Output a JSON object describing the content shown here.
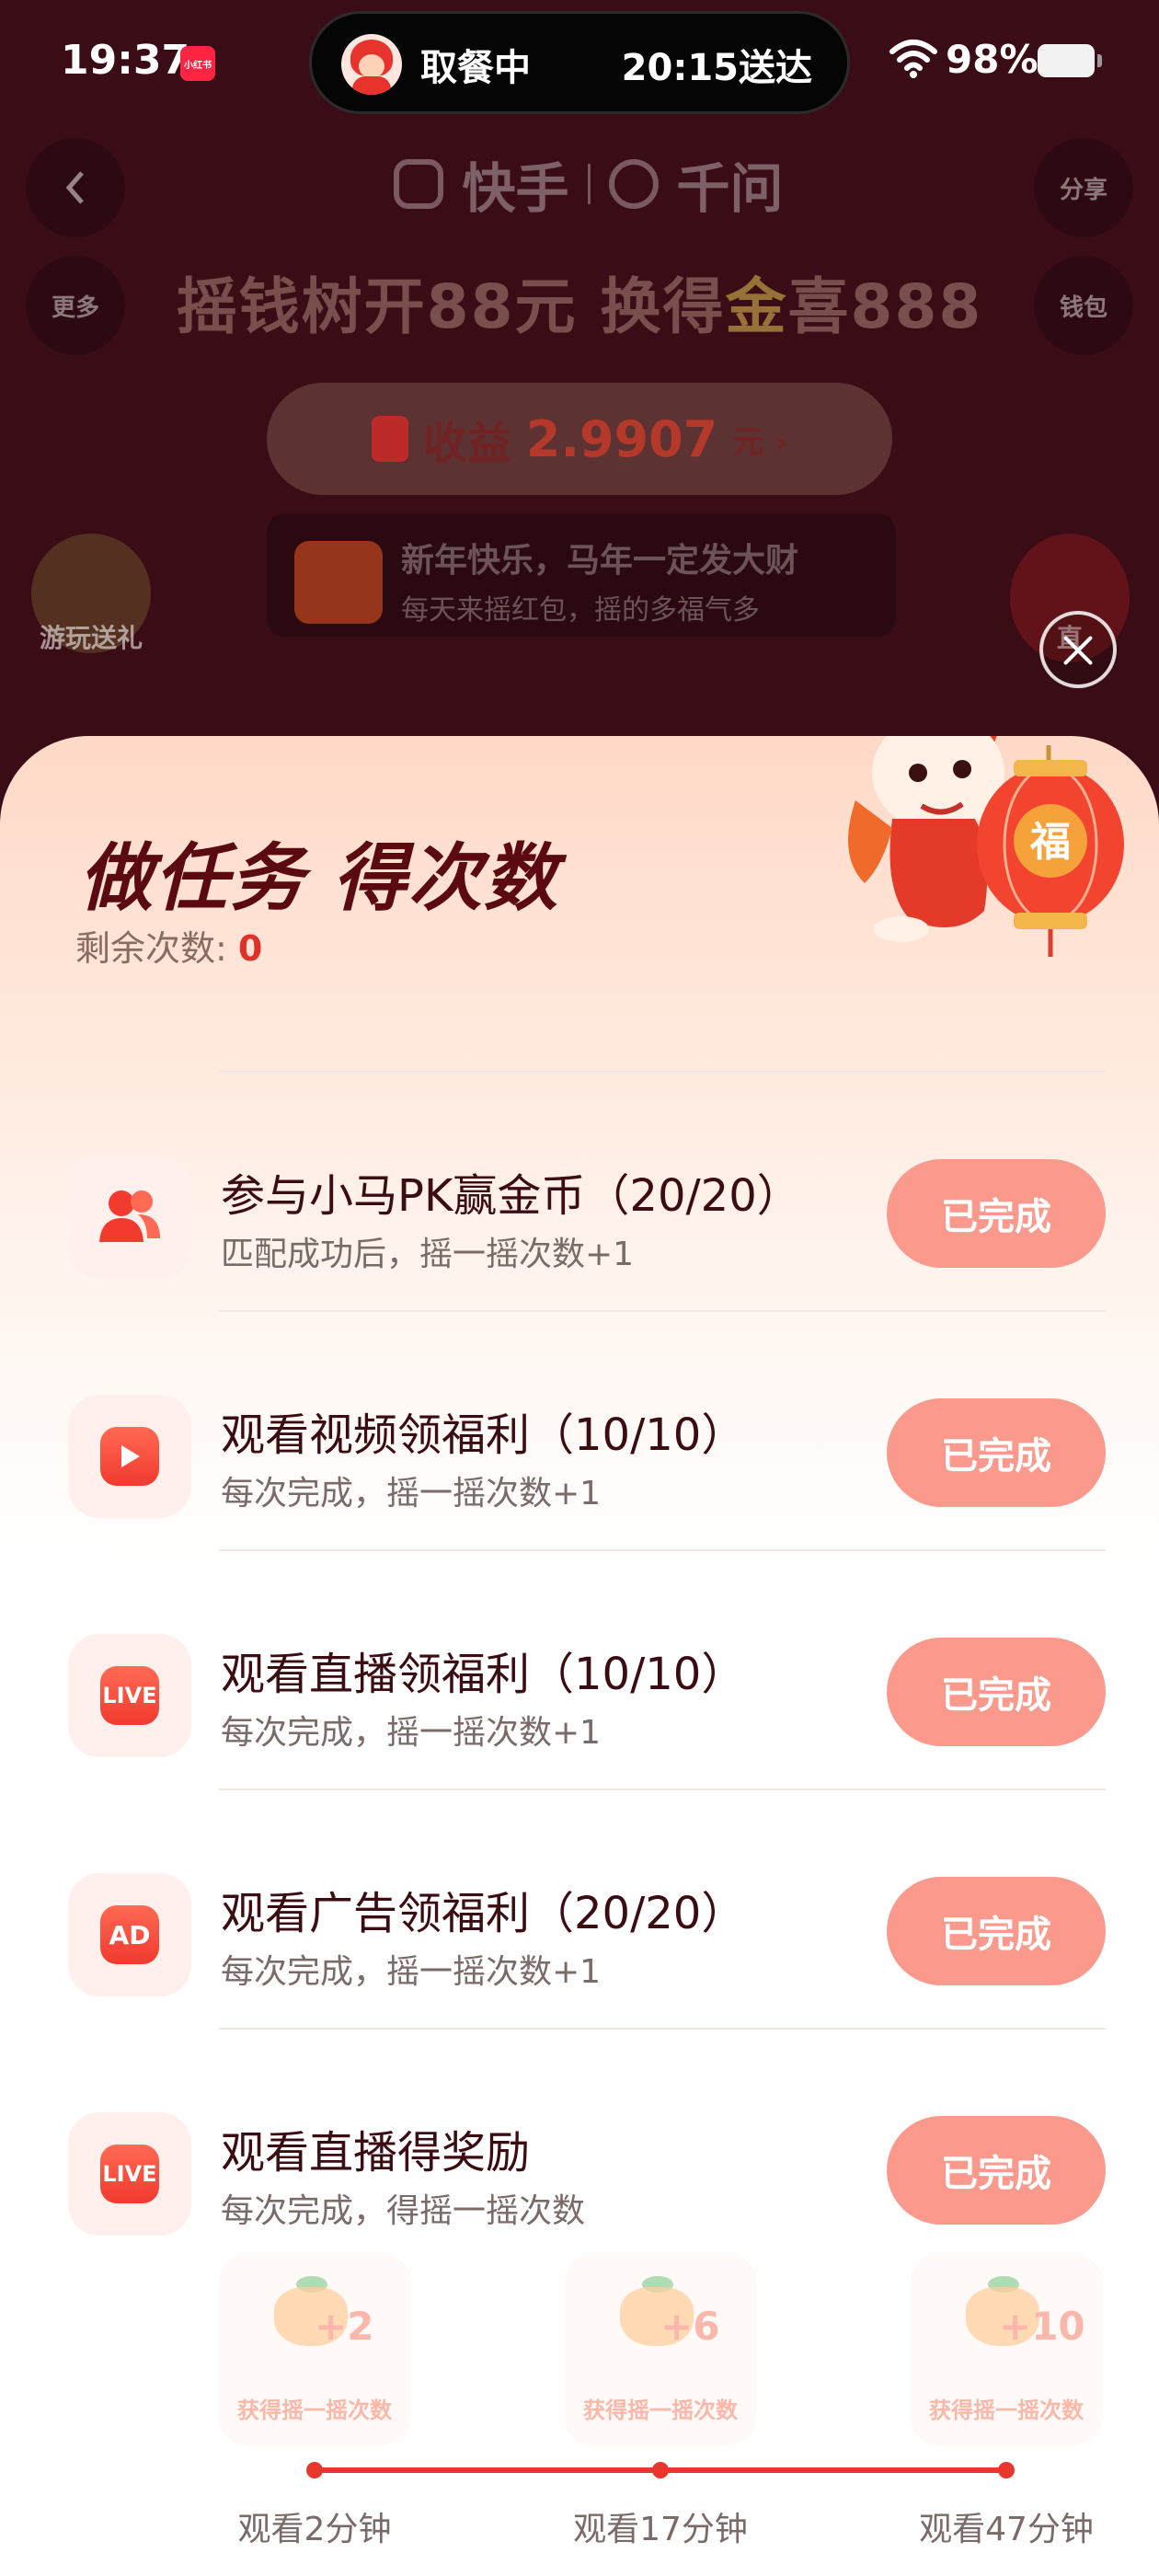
{
  "status_bar": {
    "time": "19:37",
    "app_icon_text": "小红书",
    "island_left": "取餐中",
    "island_right": "20:15送达",
    "battery": "98%"
  },
  "background_page": {
    "back_icon": "chevron-left-icon",
    "share_label": "分享",
    "brand_left": "快手",
    "brand_right": "千问",
    "more_label": "更多",
    "wallet_label": "钱包",
    "headline_pre": "摇钱树开88元 换得",
    "headline_gold": "金",
    "headline_post": "喜888",
    "earnings_label": "收益",
    "earnings_value": "2.9907",
    "earnings_unit": "元 ›",
    "notice_line1": "新年快乐，马年一定发大财",
    "notice_line2": "每天来摇红包，摇的多福气多",
    "game_gift_label": "游玩送礼",
    "right_gift_label": "直"
  },
  "sheet": {
    "title": "做任务 得次数",
    "remain_label": "剩余次数:",
    "remain_value": "0",
    "mascot_lantern_text": "福",
    "tasks": [
      {
        "title": "参与小马PK赢金币（20/20）",
        "subtitle": "匹配成功后，摇一摇次数+1",
        "button": "已完成",
        "icon": "users-icon"
      },
      {
        "title": "观看视频领福利（10/10）",
        "subtitle": "每次完成，摇一摇次数+1",
        "button": "已完成",
        "icon": "play-icon"
      },
      {
        "title": "观看直播领福利（10/10）",
        "subtitle": "每次完成，摇一摇次数+1",
        "button": "已完成",
        "icon": "live-icon",
        "icon_text": "LIVE"
      },
      {
        "title": "观看广告领福利（20/20）",
        "subtitle": "每次完成，摇一摇次数+1",
        "button": "已完成",
        "icon": "ad-icon",
        "icon_text": "AD"
      },
      {
        "title": "观看直播得奖励",
        "subtitle": "每次完成，得摇一摇次数",
        "button": "已完成",
        "icon": "live-icon",
        "icon_text": "LIVE"
      }
    ],
    "rewards": [
      {
        "plus": "+2",
        "label": "获得摇一摇次数",
        "time": "观看2分钟"
      },
      {
        "plus": "+6",
        "label": "获得摇一摇次数",
        "time": "观看17分钟"
      },
      {
        "plus": "+10",
        "label": "获得摇一摇次数",
        "time": "观看47分钟"
      }
    ]
  },
  "colors": {
    "accent": "#e8382e",
    "done_button": "#fb9a8c",
    "title": "#5a0a10"
  }
}
